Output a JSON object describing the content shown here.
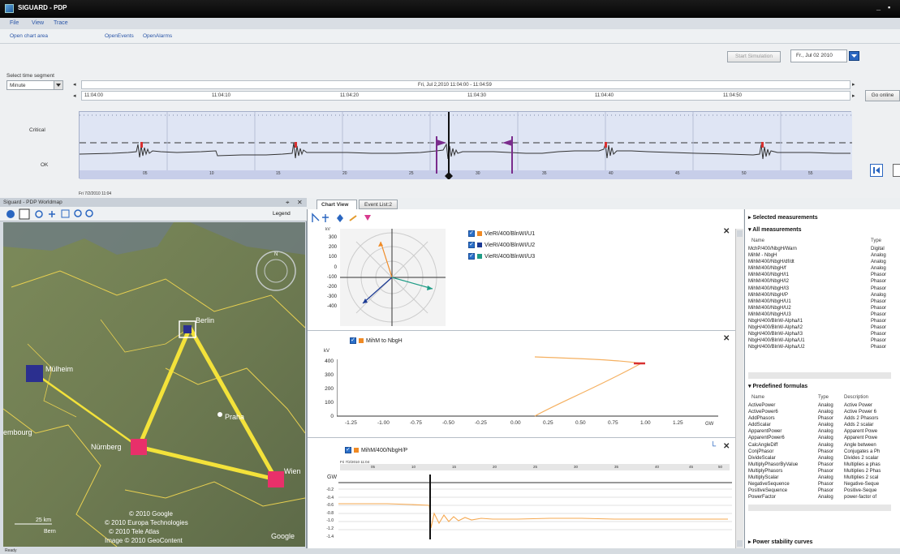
{
  "window": {
    "title": "SIGUARD - PDP",
    "minimize": "_",
    "maximize": "▪"
  },
  "menu": [
    "File",
    "View",
    "Trace"
  ],
  "links": {
    "open_chart_area": "Open chart area",
    "open_events": "OpenEvents",
    "open_alarms": "OpenAlarms"
  },
  "toolbar": {
    "start_simulation": "Start Simulation",
    "date_value": "Fr., Jul 02 2010"
  },
  "time_segment": {
    "label": "Select time segment",
    "value": "Minute"
  },
  "timeline": {
    "header": "Fri, Jul 2,2010  11:04:00 - 11:04:59",
    "ticks": [
      "11:04:00",
      "11:04:10",
      "11:04:20",
      "11:04:30",
      "11:04:40",
      "11:04:50"
    ],
    "go_online": "Go online",
    "left_arrow": "◂",
    "right_arrow": "▸"
  },
  "overview": {
    "critical_label": "Critical",
    "ok_label": "OK",
    "bottom_ticks": [
      "05",
      "10",
      "15",
      "20",
      "25",
      "30",
      "35",
      "40",
      "45",
      "50",
      "55"
    ],
    "start_caption": "Fri 7/2/2010 11:04"
  },
  "map": {
    "title": "Siguard - PDP Worldmap",
    "legend": "Legend",
    "pin_icon": "⌖",
    "close_icon": "✕",
    "cities": [
      "Berlin",
      "Mülheim",
      "Praha",
      "Wien",
      "Nürnberg",
      "embourg"
    ],
    "copyright": [
      "© 2010 Google",
      "© 2010 Europa Technologies",
      "© 2010 Tele Atlas",
      "Image © 2010 GeoContent"
    ],
    "scale": "25 km",
    "scale_caption": "Bern",
    "google_logo": "Google",
    "compass": "N"
  },
  "tabs": [
    "Chart View",
    "Event List:2"
  ],
  "phasor": {
    "unit": "kV",
    "y_ticks": [
      "300",
      "200",
      "100",
      "0",
      "-100",
      "-200",
      "-300",
      "-400"
    ],
    "legend": [
      "VieRI/400/BlnWI/U1",
      "VieRI/400/BlnWI/U2",
      "VieRI/400/BlnWI/U3"
    ],
    "colors": [
      "#f08a24",
      "#1b3a94",
      "#1f9c86"
    ]
  },
  "trajectory": {
    "legend": "MihM to NbgH",
    "unit_y": "kV",
    "unit_x": "GW",
    "y_ticks": [
      "400",
      "300",
      "200",
      "100",
      "0"
    ],
    "x_ticks": [
      "-1.25",
      "-1.00",
      "-0.75",
      "-0.50",
      "-0.25",
      "0.00",
      "0.25",
      "0.50",
      "0.75",
      "1.00",
      "1.25"
    ]
  },
  "power": {
    "legend": "MihM/400/NbgH/P",
    "caption": "Fri 7/2/2010 11:04",
    "unit": "GW",
    "y_ticks": [
      "-0.2",
      "-0.4",
      "-0.6",
      "-0.8",
      "-1.0",
      "-1.2",
      "-1.4"
    ],
    "x_ticks": [
      "05",
      "10",
      "15",
      "20",
      "25",
      "30",
      "35",
      "40",
      "45",
      "50"
    ],
    "chart_icon": "└"
  },
  "selected": {
    "title": "Selected measurements",
    "all_title": "All measurements",
    "col_name": "Name",
    "col_type": "Type"
  },
  "measurements": [
    [
      "MchP/400/NbgH/Warn",
      "Digital"
    ],
    [
      "MihM - NbgH",
      "Analog"
    ],
    [
      "MihM/400/NbgH/df/dt",
      "Analog"
    ],
    [
      "MihM/400/NbgH/f",
      "Analog"
    ],
    [
      "MihM/400/NbgH/I1",
      "Phasor"
    ],
    [
      "MihM/400/NbgH/I2",
      "Phasor"
    ],
    [
      "MihM/400/NbgH/I3",
      "Phasor"
    ],
    [
      "MihM/400/NbgH/P",
      "Analog"
    ],
    [
      "MihM/400/NbgH/U1",
      "Phasor"
    ],
    [
      "MihM/400/NbgH/U2",
      "Phasor"
    ],
    [
      "MihM/400/NbgH/U3",
      "Phasor"
    ],
    [
      "NbgH/400/BlnW-Alpha/I1",
      "Phasor"
    ],
    [
      "NbgH/400/BlnW-Alpha/I2",
      "Phasor"
    ],
    [
      "NbgH/400/BlnW-Alpha/I3",
      "Phasor"
    ],
    [
      "NbgH/400/BlnW-Alpha/U1",
      "Phasor"
    ],
    [
      "NbgH/400/BlnW-Alpha/U2",
      "Phasor"
    ]
  ],
  "formulas_head": {
    "title": "Predefined formulas",
    "col_name": "Name",
    "col_type": "Type",
    "col_desc": "Description"
  },
  "formulas": [
    [
      "ActivePower",
      "Analog",
      "Active Power"
    ],
    [
      "ActivePower6",
      "Analog",
      "Active Power 6"
    ],
    [
      "AddPhasors",
      "Phasor",
      "Adds 2 Phasors"
    ],
    [
      "AddScalar",
      "Analog",
      "Adds 2 scalar"
    ],
    [
      "ApparentPower",
      "Analog",
      "Apparent Powe"
    ],
    [
      "ApparentPower6",
      "Analog",
      "Apparent Powe"
    ],
    [
      "CalcAngleDiff",
      "Analog",
      "Angle between"
    ],
    [
      "ConjPhasor",
      "Phasor",
      "Conjugates a Ph"
    ],
    [
      "DivideScalar",
      "Analog",
      "Divides 2 scalar"
    ],
    [
      "MultiplyPhasorByValue",
      "Phasor",
      "Multiplies a phas"
    ],
    [
      "MultiplyPhasors",
      "Phasor",
      "Multiplies 2 Phas"
    ],
    [
      "MultiplyScalar",
      "Analog",
      "Multiplies 2 scal"
    ],
    [
      "NegativeSequence",
      "Phasor",
      "Negative-Seque"
    ],
    [
      "PositiveSequence",
      "Phasor",
      "Positive-Seque"
    ],
    [
      "PowerFactor",
      "Analog",
      "power-factor of"
    ]
  ],
  "stability": "Power stability curves",
  "status": "Ready"
}
